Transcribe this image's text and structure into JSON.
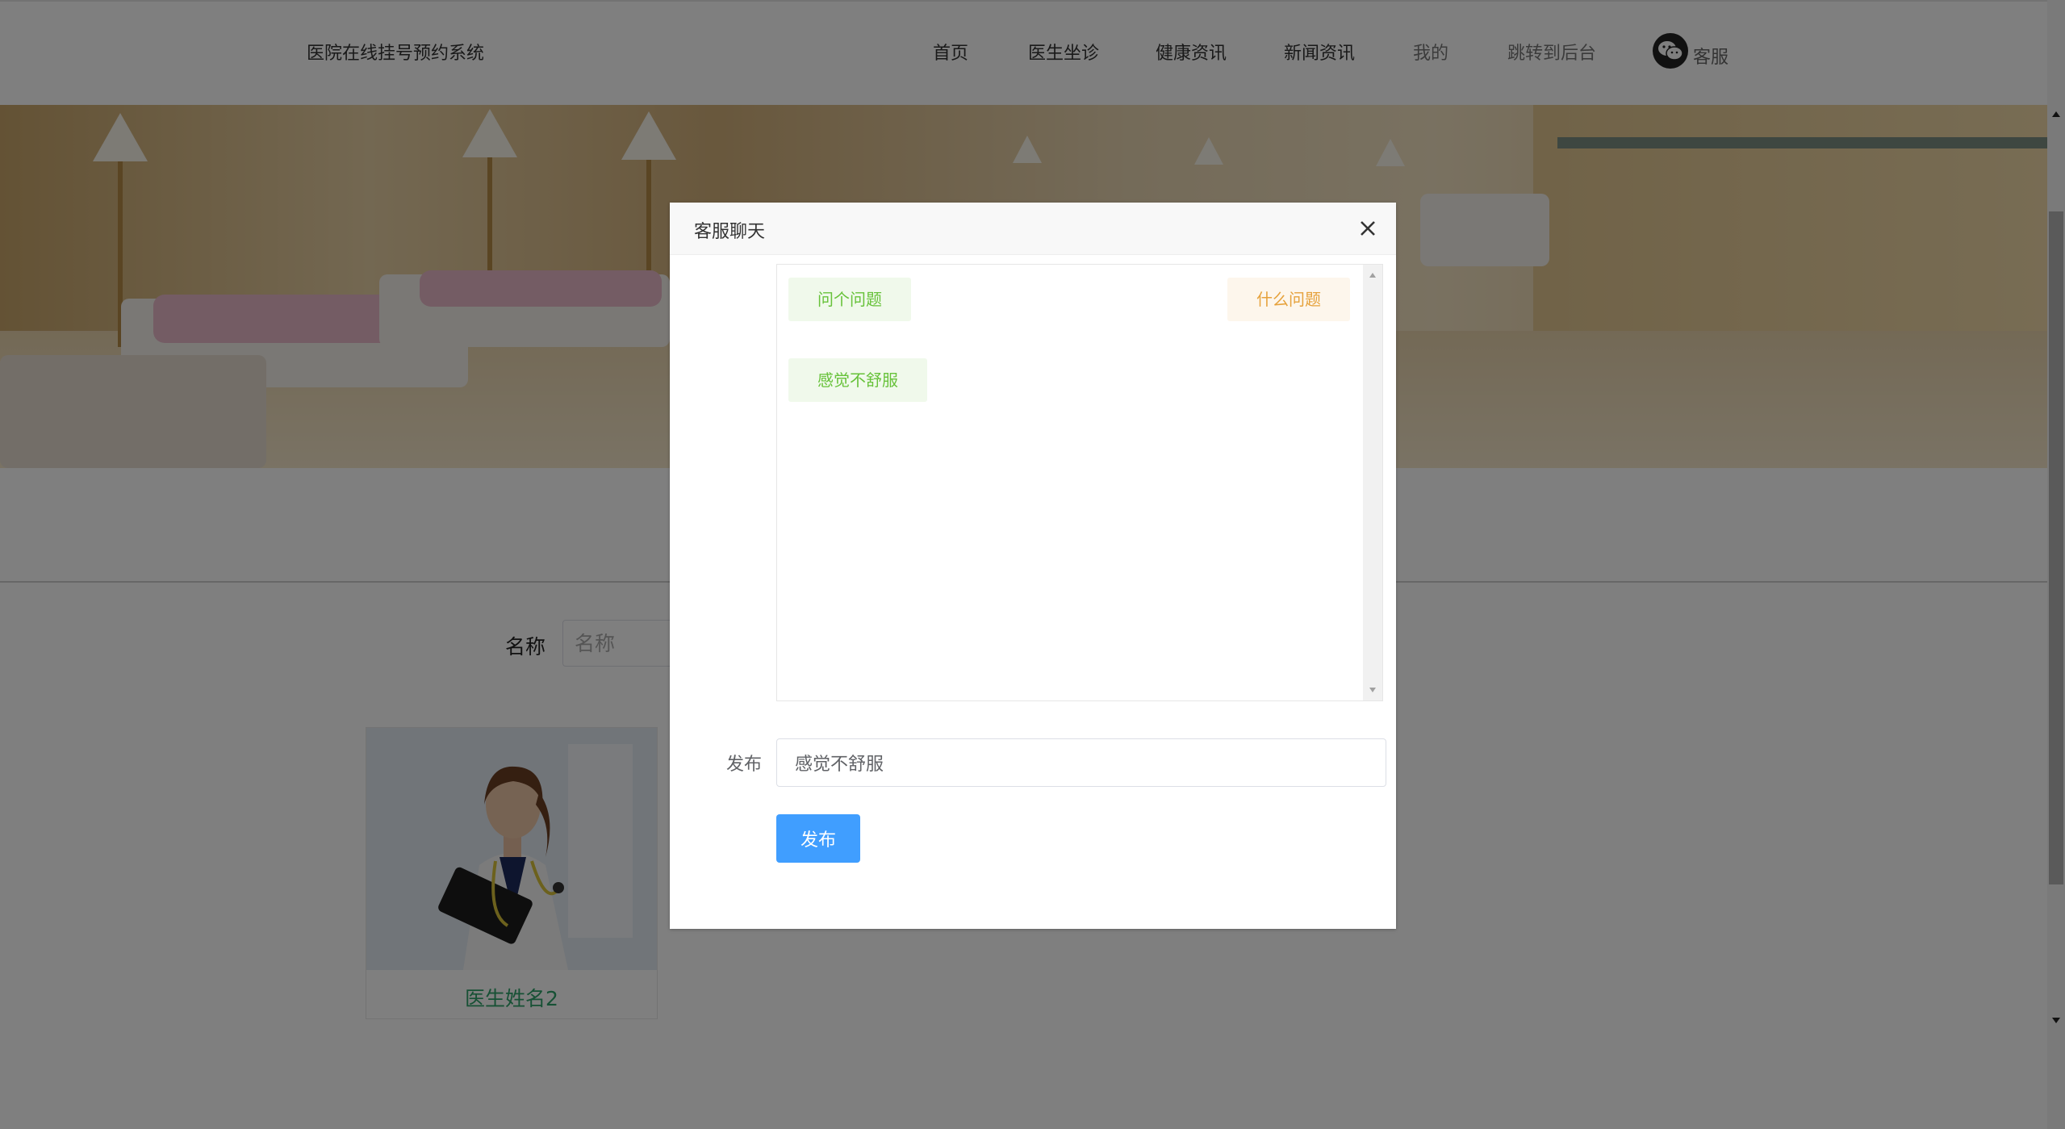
{
  "header": {
    "site_title": "医院在线挂号预约系统",
    "nav": {
      "home": "首页",
      "doctors": "医生坐诊",
      "health": "健康资讯",
      "news": "新闻资讯",
      "mine": "我的",
      "admin": "跳转到后台",
      "service": "客服"
    },
    "service_icon": "wechat-icon"
  },
  "search": {
    "label": "名称",
    "placeholder": "名称",
    "value": ""
  },
  "doctor_card": {
    "name": "医生姓名2"
  },
  "chat_dialog": {
    "title": "客服聊天",
    "close_icon": "close-icon",
    "messages": [
      {
        "side": "left",
        "text": "问个问题"
      },
      {
        "side": "right",
        "text": "什么问题"
      },
      {
        "side": "left",
        "text": "感觉不舒服"
      }
    ],
    "form": {
      "label": "发布",
      "input_value": "感觉不舒服",
      "submit_label": "发布"
    }
  },
  "colors": {
    "primary_button": "#409eff",
    "user_bubble_bg": "#f0f9eb",
    "user_bubble_text": "#67c23a",
    "staff_bubble_bg": "#fdf6ec",
    "staff_bubble_text": "#e6a23c",
    "doctor_name": "#2fa36a",
    "overlay": "rgba(0,0,0,0.5)"
  }
}
